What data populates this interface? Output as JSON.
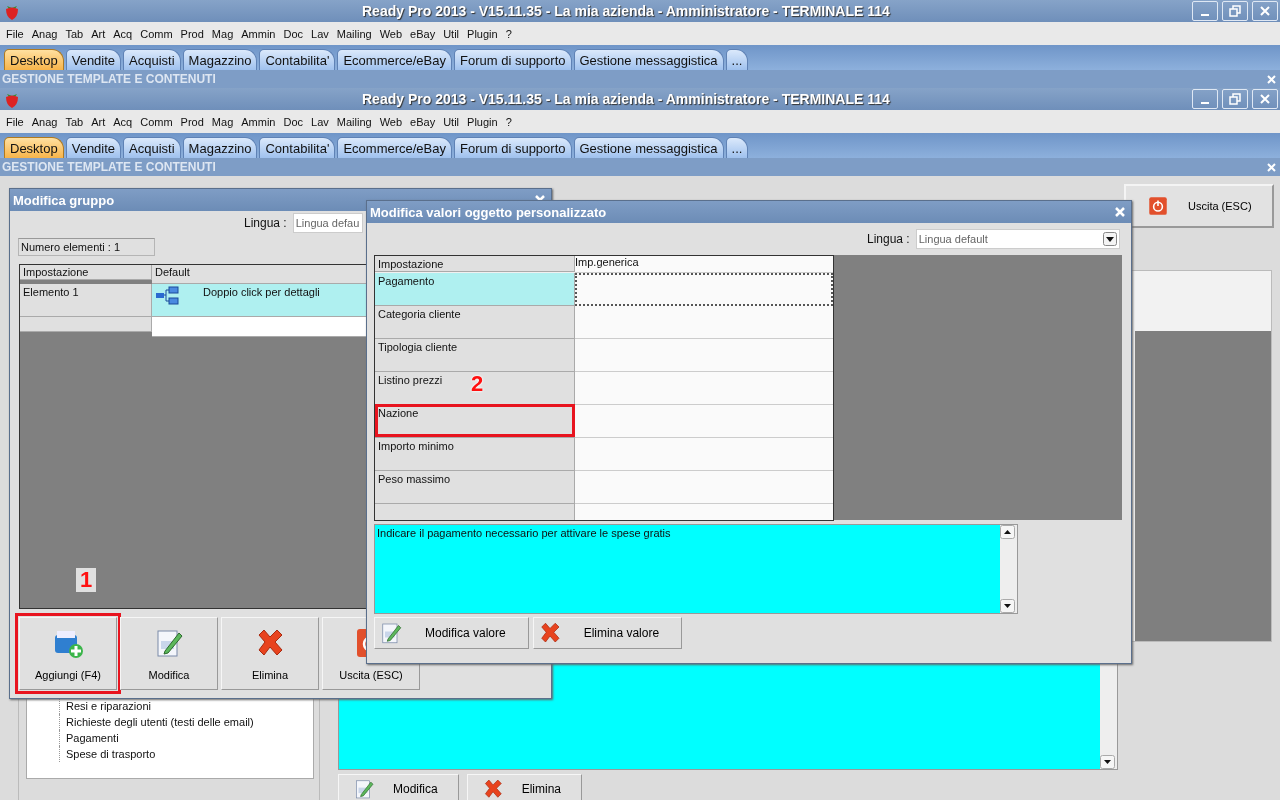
{
  "app_window": {
    "title": "Ready Pro 2013 - V15.11.35 - La mia azienda - Amministratore - TERMINALE 114",
    "menu": [
      "File",
      "Anag",
      "Tab",
      "Art",
      "Acq",
      "Comm",
      "Prod",
      "Mag",
      "Ammin",
      "Doc",
      "Lav",
      "Mailing",
      "Web",
      "eBay",
      "Util",
      "Plugin",
      "?"
    ],
    "tabs": [
      {
        "label": "Desktop",
        "selected": true
      },
      {
        "label": "Vendite",
        "selected": false
      },
      {
        "label": "Acquisti",
        "selected": false
      },
      {
        "label": "Magazzino",
        "selected": false
      },
      {
        "label": "Contabilita'",
        "selected": false
      },
      {
        "label": "Ecommerce/eBay",
        "selected": false
      },
      {
        "label": "Forum di supporto",
        "selected": false
      },
      {
        "label": "Gestione messaggistica",
        "selected": false
      },
      {
        "label": "...",
        "selected": false
      }
    ],
    "section_title": "GESTIONE TEMPLATE E CONTENUTI"
  },
  "inner_app_window": {
    "title": "Ready Pro 2013 - V15.11.35 - La mia azienda - Amministratore - TERMINALE 114",
    "menu": [
      "File",
      "Anag",
      "Tab",
      "Art",
      "Acq",
      "Comm",
      "Prod",
      "Mag",
      "Ammin",
      "Doc",
      "Lav",
      "Mailing",
      "Web",
      "eBay",
      "Util",
      "Plugin",
      "?"
    ],
    "tabs": [
      {
        "label": "Desktop",
        "selected": true
      },
      {
        "label": "Vendite",
        "selected": false
      },
      {
        "label": "Acquisti",
        "selected": false
      },
      {
        "label": "Magazzino",
        "selected": false
      },
      {
        "label": "Contabilita'",
        "selected": false
      },
      {
        "label": "Ecommerce/eBay",
        "selected": false
      },
      {
        "label": "Forum di supporto",
        "selected": false
      },
      {
        "label": "Gestione messaggistica",
        "selected": false
      },
      {
        "label": "...",
        "selected": false
      }
    ],
    "section_title": "GESTIONE TEMPLATE E CONTENUTI"
  },
  "desktop": {
    "exit_button": {
      "label": "Uscita (ESC)",
      "kind": "exit"
    },
    "tree_items": [
      "Resi e riparazioni",
      "Richieste degli utenti (testi delle email)",
      "Pagamenti",
      "Spese di trasporto"
    ],
    "buttons": [
      {
        "label": "Modifica",
        "kind": "edit"
      },
      {
        "label": "Elimina",
        "kind": "delete"
      }
    ]
  },
  "group_dialog": {
    "title": "Modifica gruppo",
    "language_label": "Lingua :",
    "language_value": "Lingua defau",
    "count": "Numero elementi : 1",
    "columns": [
      "Impostazione",
      "Default"
    ],
    "rows": [
      {
        "setting": "Elemento 1",
        "value": "Doppio click per dettagli",
        "selected": true
      }
    ],
    "buttons": [
      {
        "label": "Aggiungi (F4)",
        "kind": "add",
        "callout": "1"
      },
      {
        "label": "Modifica",
        "kind": "edit"
      },
      {
        "label": "Elimina",
        "kind": "delete"
      },
      {
        "label": "Uscita (ESC)",
        "kind": "exit"
      }
    ]
  },
  "values_dialog": {
    "title": "Modifica valori oggetto personalizzato",
    "language_label": "Lingua :",
    "language_value": "Lingua default",
    "columns": [
      "Impostazione",
      "Imp.generica"
    ],
    "rows": [
      {
        "setting": "Pagamento",
        "selected": true
      },
      {
        "setting": "Categoria cliente",
        "selected": false
      },
      {
        "setting": "Tipologia cliente",
        "selected": false
      },
      {
        "setting": "Listino prezzi",
        "selected": false
      },
      {
        "setting": "Nazione",
        "selected": false,
        "callout": "2"
      },
      {
        "setting": "Importo minimo",
        "selected": false
      },
      {
        "setting": "Peso massimo",
        "selected": false
      }
    ],
    "description": "Indicare il pagamento necessario per attivare le spese gratis",
    "buttons": [
      {
        "label": "Modifica valore",
        "kind": "edit"
      },
      {
        "label": "Elimina valore",
        "kind": "delete"
      }
    ]
  }
}
